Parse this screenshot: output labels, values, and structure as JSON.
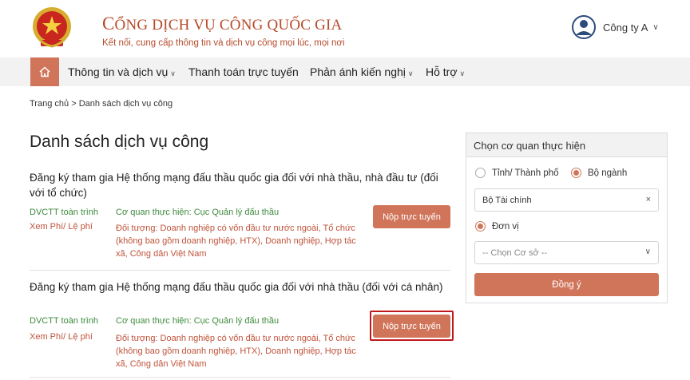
{
  "header": {
    "title_initial": "C",
    "title_rest": "ỔNG DỊCH VỤ CÔNG QUỐC GIA",
    "subtitle": "Kết nối, cung cấp thông tin và dịch vụ công mọi lúc, mọi nơi",
    "user_name": "Công ty A",
    "user_caret": "∨"
  },
  "nav": {
    "home_icon": "home-icon",
    "items": [
      {
        "label": "Thông tin và dịch vụ",
        "chev": "∨"
      },
      {
        "label": "Thanh toán trực tuyến"
      },
      {
        "label": "Phản ánh kiến nghị",
        "chev": "∨"
      },
      {
        "label": "Hỗ trợ",
        "chev": "∨"
      }
    ]
  },
  "breadcrumb": {
    "home": "Trang chủ",
    "sep": ">",
    "current": "Danh sách dịch vụ công"
  },
  "page_title": "Danh sách dịch vụ công",
  "services": [
    {
      "title": "Đăng ký tham gia Hệ thống mạng đấu thầu quốc gia đối với nhà thầu, nhà đầu tư (đối với tổ chức)",
      "type": "DVCTT toàn trình",
      "fee": "Xem Phí/ Lệ phí",
      "agency": "Cơ quan thực hiện: Cục Quản lý đấu thầu",
      "target": "Đối tượng: Doanh nghiệp có vốn đầu tư nước ngoài, Tổ chức (không bao gồm doanh nghiệp, HTX), Doanh nghiệp, Hợp tác xã, Công dân Việt Nam",
      "button": "Nộp trực tuyến"
    },
    {
      "title": "Đăng ký tham gia Hệ thống mạng đấu thầu quốc gia đối với nhà thầu (đối với cá nhân)",
      "type": "DVCTT toàn trình",
      "fee": "Xem Phí/ Lệ phí",
      "agency": "Cơ quan thực hiện: Cục Quản lý đấu thầu",
      "target": "Đối tượng: Doanh nghiệp có vốn đầu tư nước ngoài, Tổ chức (không bao gồm doanh nghiệp, HTX), Doanh nghiệp, Hợp tác xã, Công dân Việt Nam",
      "button": "Nộp trực tuyến"
    }
  ],
  "filter": {
    "heading": "Chọn cơ quan thực hiện",
    "radio_province": "Tỉnh/ Thành phố",
    "radio_ministry": "Bộ ngành",
    "ministry_value": "Bộ Tài chính",
    "clear_symbol": "×",
    "radio_unit": "Đơn vị",
    "unit_placeholder": "-- Chọn Cơ sở --",
    "select_chev": "∨",
    "submit": "Đồng ý"
  },
  "colors": {
    "accent": "#d0755a",
    "brand": "#b64a2a",
    "green": "#3d8b3d",
    "highlight": "#c0191b"
  }
}
